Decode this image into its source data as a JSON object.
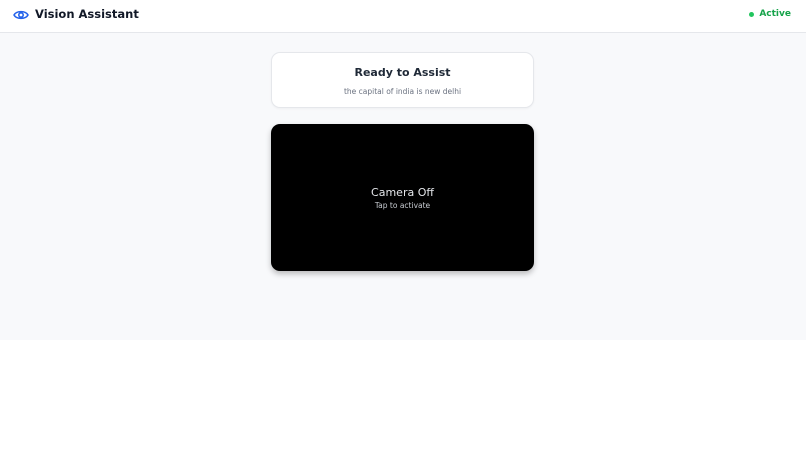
{
  "header": {
    "title": "Vision Assistant",
    "logo_icon": "eye-icon",
    "status": {
      "label": "Active",
      "color": "#16a34a"
    }
  },
  "status_card": {
    "title": "Ready to Assist",
    "message": "the capital of india is new delhi"
  },
  "camera": {
    "title": "Camera Off",
    "hint": "Tap to activate",
    "background": "#000000"
  },
  "colors": {
    "accent": "#2563eb",
    "active": "#22c55e",
    "page_background": "#f8f9fb"
  }
}
